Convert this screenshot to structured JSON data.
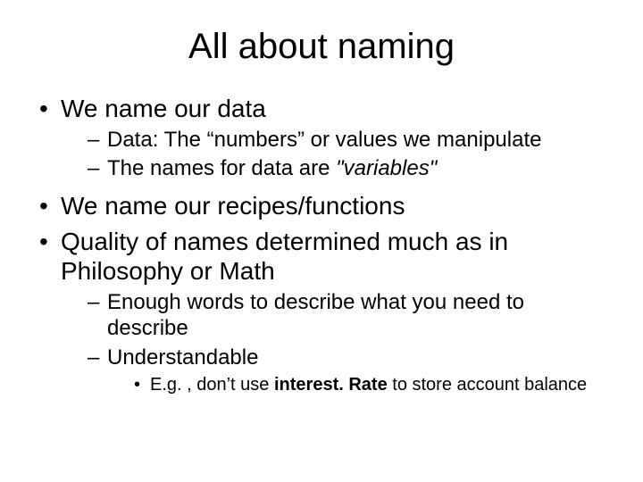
{
  "title": "All about naming",
  "b1": "We name our data",
  "b1s1_pre": "Data: The “numbers” or values we manipulate",
  "b1s2_pre": "The names for data are ",
  "b1s2_var": "\"variables\"",
  "b2": "We name our recipes/functions",
  "b3": "Quality of names determined much as in Philosophy or Math",
  "b3s1": "Enough words to describe what you need to describe",
  "b3s2": "Understandable",
  "b3s2a_pre": "E.g. , don’t use ",
  "b3s2a_bold": "interest. Rate",
  "b3s2a_post": " to store account balance"
}
